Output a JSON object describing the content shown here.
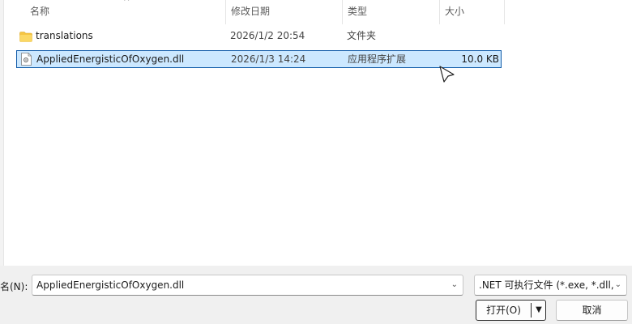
{
  "columns": {
    "name": "名称",
    "modified": "修改日期",
    "type": "类型",
    "size": "大小",
    "sort_glyph": "^"
  },
  "files": [
    {
      "name": "translations",
      "modified": "2026/1/2 20:54",
      "type": "文件夹",
      "size": "",
      "icon": "folder-icon",
      "selected": false
    },
    {
      "name": "AppliedEnergisticOfOxygen.dll",
      "modified": "2026/1/3 14:24",
      "type": "应用程序扩展",
      "size": "10.0 KB",
      "icon": "dll-file-icon",
      "selected": true
    }
  ],
  "footer": {
    "filename_label": "名(N):",
    "filename_value": "AppliedEnergisticOfOxygen.dll",
    "filetype_value": ".NET 可执行文件 (*.exe, *.dll, ",
    "open_label": "打开(O)",
    "cancel_label": "取消"
  },
  "colors": {
    "selection_bg": "#cce8ff",
    "selection_border": "#0f5aa8",
    "folder": "#f6c543"
  }
}
